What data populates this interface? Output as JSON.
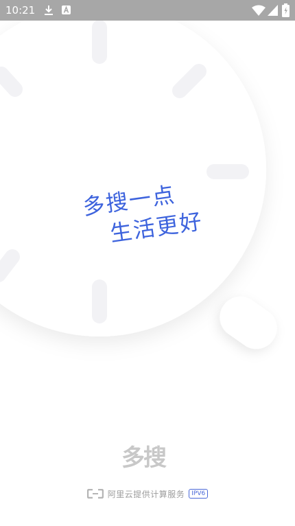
{
  "status_bar": {
    "time": "10:21",
    "icons": [
      "download-icon",
      "a-notification-icon",
      "wifi-icon",
      "signal-icon",
      "battery-icon"
    ]
  },
  "splash": {
    "slogan_line1": "多搜一点",
    "slogan_line2": "生活更好",
    "app_logo_text": "多搜",
    "accent_color": "#3d63dd"
  },
  "footer": {
    "provider": "阿里云提供计算服务",
    "badge": "IPV6"
  }
}
